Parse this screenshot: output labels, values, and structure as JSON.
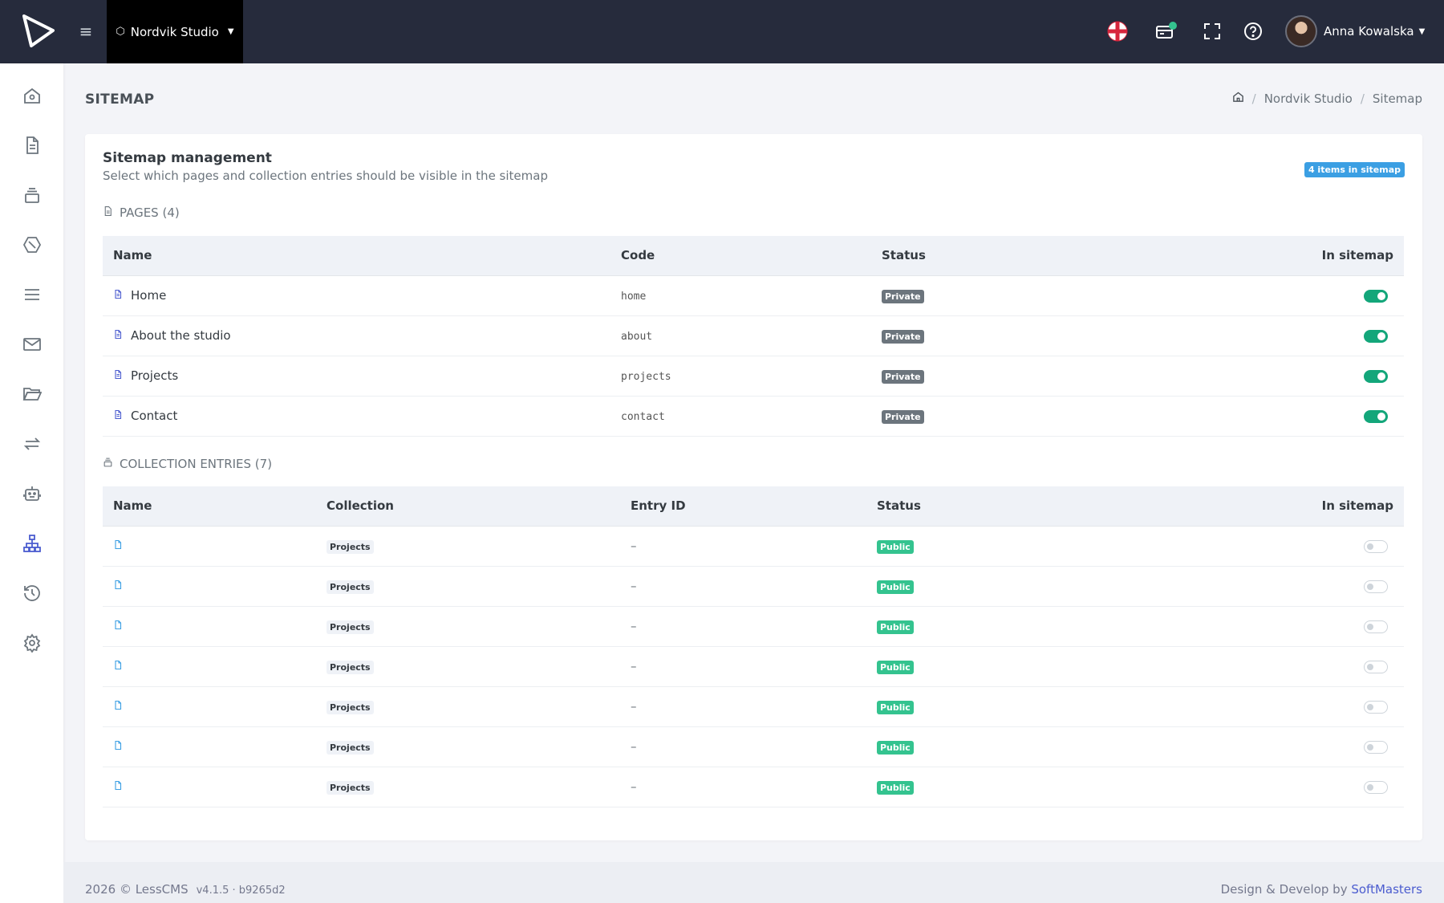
{
  "topbar": {
    "project_name": "Nordvik Studio",
    "user_name": "Anna Kowalska"
  },
  "page": {
    "title": "SITEMAP",
    "breadcrumb": [
      "Nordvik Studio",
      "Sitemap"
    ]
  },
  "card": {
    "title": "Sitemap management",
    "subtitle": "Select which pages and collection entries should be visible in the sitemap",
    "count_badge": "4 items in sitemap"
  },
  "pages_section": {
    "heading": "PAGES (4)",
    "columns": [
      "Name",
      "Code",
      "Status",
      "In sitemap"
    ],
    "rows": [
      {
        "name": "Home",
        "code": "home",
        "status": "Private",
        "in_sitemap": true
      },
      {
        "name": "About the studio",
        "code": "about",
        "status": "Private",
        "in_sitemap": true
      },
      {
        "name": "Projects",
        "code": "projects",
        "status": "Private",
        "in_sitemap": true
      },
      {
        "name": "Contact",
        "code": "contact",
        "status": "Private",
        "in_sitemap": true
      }
    ]
  },
  "entries_section": {
    "heading": "COLLECTION ENTRIES (7)",
    "columns": [
      "Name",
      "Collection",
      "Entry ID",
      "Status",
      "In sitemap"
    ],
    "rows": [
      {
        "name": "",
        "collection": "Projects",
        "entry_id": "–",
        "status": "Public",
        "in_sitemap": false
      },
      {
        "name": "",
        "collection": "Projects",
        "entry_id": "–",
        "status": "Public",
        "in_sitemap": false
      },
      {
        "name": "",
        "collection": "Projects",
        "entry_id": "–",
        "status": "Public",
        "in_sitemap": false
      },
      {
        "name": "",
        "collection": "Projects",
        "entry_id": "–",
        "status": "Public",
        "in_sitemap": false
      },
      {
        "name": "",
        "collection": "Projects",
        "entry_id": "–",
        "status": "Public",
        "in_sitemap": false
      },
      {
        "name": "",
        "collection": "Projects",
        "entry_id": "–",
        "status": "Public",
        "in_sitemap": false
      },
      {
        "name": "",
        "collection": "Projects",
        "entry_id": "–",
        "status": "Public",
        "in_sitemap": false
      }
    ]
  },
  "footer": {
    "copyright": "2026 © LessCMS",
    "version": "v4.1.5 · b9265d2",
    "credit_prefix": "Design & Develop by",
    "credit_brand": "SoftMasters"
  },
  "colors": {
    "topbar": "#262b3c",
    "accent": "#4b5ccf",
    "toggle_on": "#13a67a",
    "public": "#34c38f",
    "private": "#6c757d",
    "count_badge": "#3b9fe3"
  },
  "icons": {
    "sidebar": [
      "home-icon",
      "document-icon",
      "layers-icon",
      "hexagon-icon",
      "menu-icon",
      "mail-icon",
      "folder-icon",
      "arrows-swap-icon",
      "robot-icon",
      "sitemap-icon",
      "history-icon",
      "gear-icon"
    ],
    "topbar": [
      "logo-icon",
      "hamburger-icon",
      "package-icon",
      "flag-england-icon",
      "notification-card-icon",
      "fullscreen-icon",
      "help-icon",
      "avatar"
    ]
  }
}
